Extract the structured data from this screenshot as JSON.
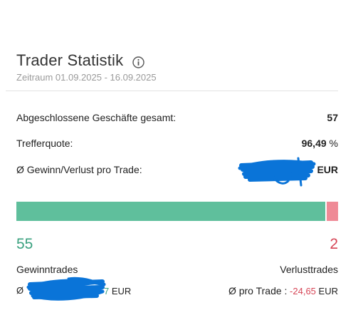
{
  "header": {
    "title": "Trader Statistik",
    "period": "Zeitraum 01.09.2025 - 16.09.2025"
  },
  "stats": {
    "closed_trades_label": "Abgeschlossene Geschäfte gesamt:",
    "closed_trades_value": "57",
    "hit_rate_label": "Trefferquote:",
    "hit_rate_value": "96,49",
    "hit_rate_unit": "%",
    "avg_pl_label": "Ø Gewinn/Verlust pro Trade:",
    "avg_pl_unit": "EUR"
  },
  "ratio": {
    "win_fraction": 0.9649,
    "win_count": "55",
    "loss_count": "2",
    "win_color": "#5fbf9c",
    "loss_color": "#ef8a96"
  },
  "winners": {
    "label": "Gewinntrades",
    "avg_prefix": "Ø",
    "avg_value_tail": "7",
    "avg_unit": "EUR"
  },
  "losers": {
    "label": "Verlusttrades",
    "avg_prefix": "Ø pro Trade :",
    "avg_value": "-24,65",
    "avg_unit": "EUR"
  },
  "colors": {
    "redaction": "#0a74d8",
    "positive": "#3aa17f",
    "negative": "#d64556"
  }
}
